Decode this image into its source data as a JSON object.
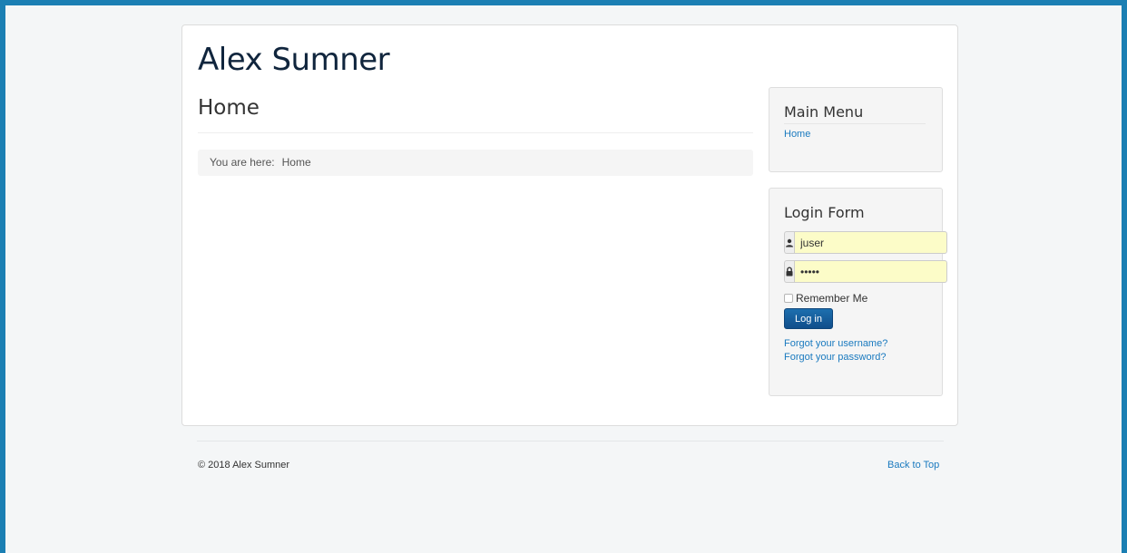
{
  "site": {
    "title": "Alex Sumner"
  },
  "main": {
    "page_title": "Home",
    "breadcrumb": {
      "prefix": "You are here:",
      "current": "Home"
    }
  },
  "main_menu": {
    "title": "Main Menu",
    "items": [
      {
        "label": "Home"
      }
    ]
  },
  "login_form": {
    "title": "Login Form",
    "username": {
      "value": "juser",
      "icon": "user-icon"
    },
    "password": {
      "value": "•••••",
      "icon": "lock-icon"
    },
    "remember_label": "Remember Me",
    "remember_checked": false,
    "submit_label": "Log in",
    "forgot_username": "Forgot your username?",
    "forgot_password": "Forgot your password?"
  },
  "footer": {
    "copyright": "© 2018 Alex Sumner",
    "back_to_top": "Back to Top"
  },
  "colors": {
    "accent": "#1b7fb3",
    "link": "#1a7abf",
    "button": "#104e8b",
    "autofill": "#fcfcc8"
  }
}
